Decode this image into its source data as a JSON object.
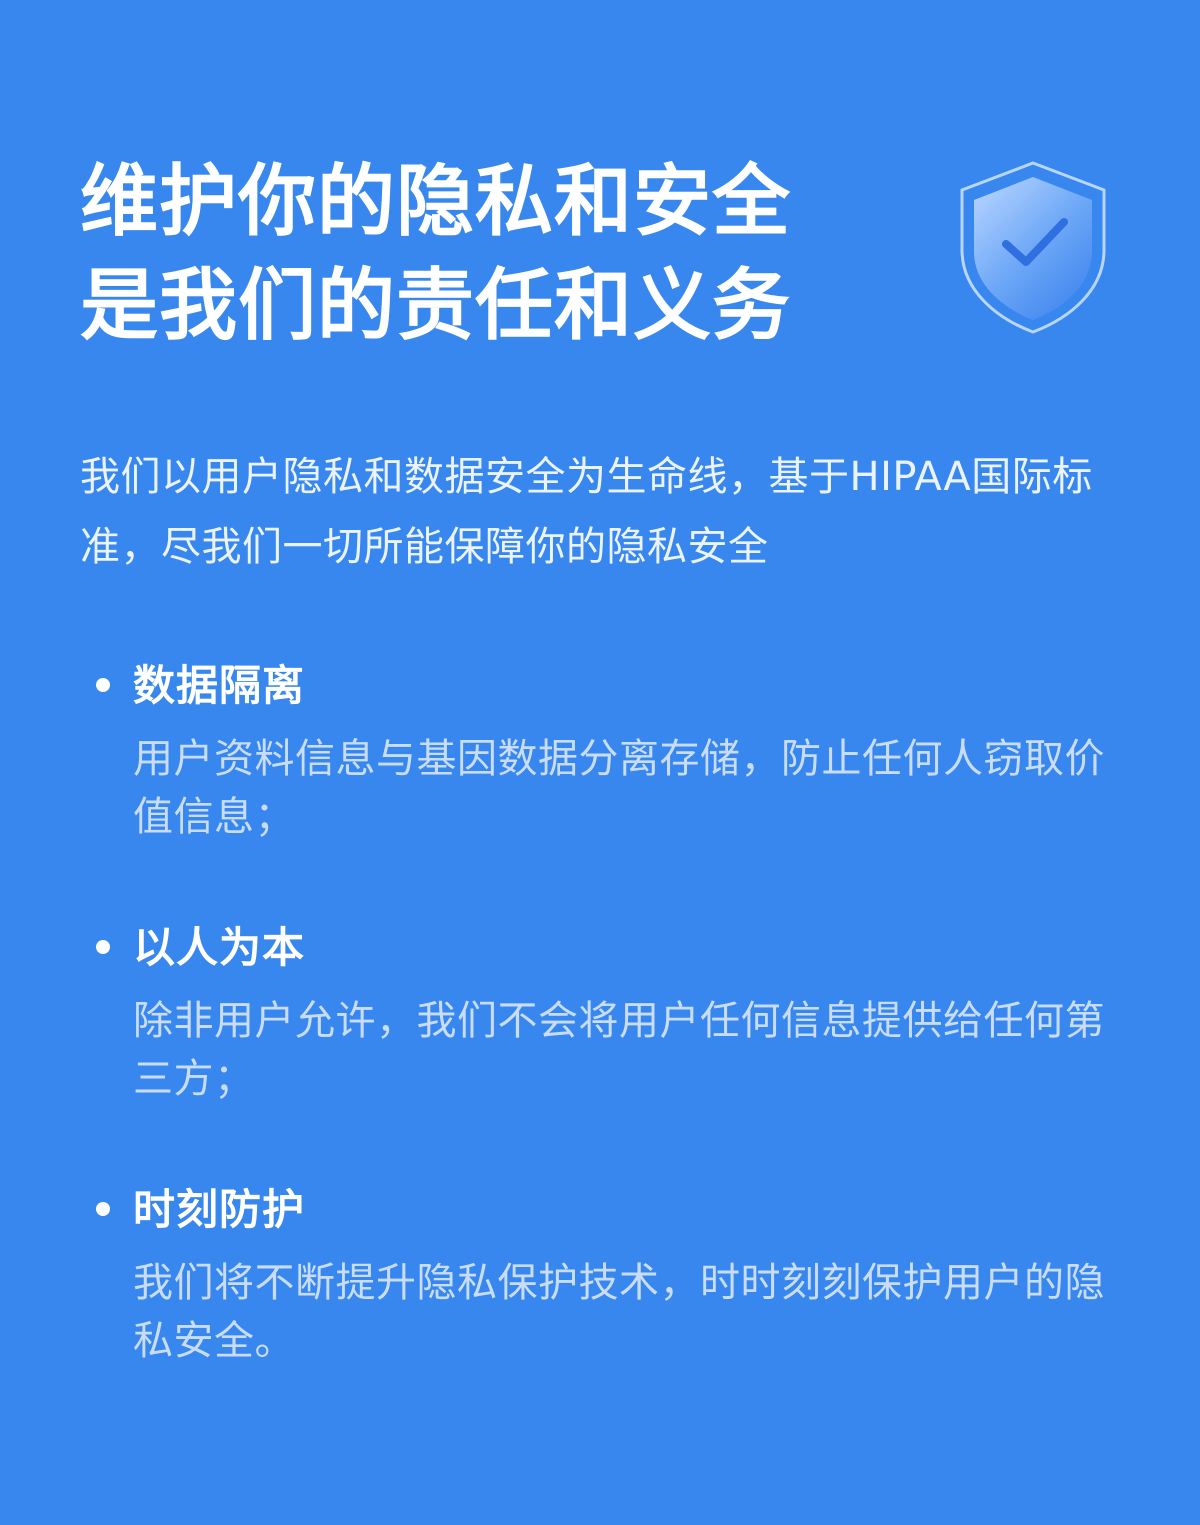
{
  "header": {
    "title_line1": "维护你的隐私和安全",
    "title_line2": "是我们的责任和义务",
    "icon": "shield-check-icon"
  },
  "intro": {
    "text": "我们以用户隐私和数据安全为生命线，基于HIPAA国际标准，尽我们一切所能保障你的隐私安全"
  },
  "features": [
    {
      "title": "数据隔离",
      "description": "用户资料信息与基因数据分离存储，防止任何人窃取价值信息；"
    },
    {
      "title": "以人为本",
      "description": "除非用户允许，我们不会将用户任何信息提供给任何第三方；"
    },
    {
      "title": "时刻防护",
      "description": "我们将不断提升隐私保护技术，时时刻刻保护用户的隐私安全。"
    }
  ],
  "colors": {
    "background": "#3787ef",
    "text_primary": "#ffffff",
    "text_secondary": "#c9ddfb"
  }
}
